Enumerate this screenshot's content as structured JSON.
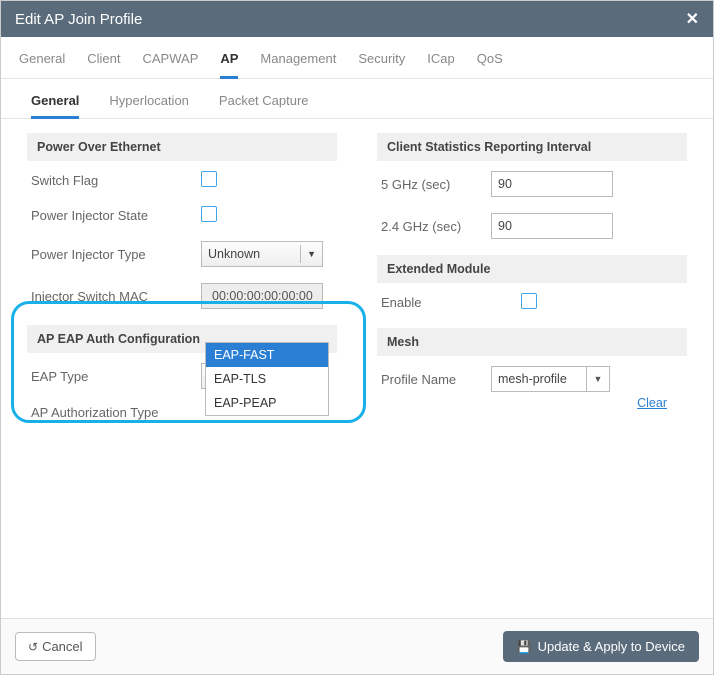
{
  "header": {
    "title": "Edit AP Join Profile"
  },
  "topTabs": [
    "General",
    "Client",
    "CAPWAP",
    "AP",
    "Management",
    "Security",
    "ICap",
    "QoS"
  ],
  "topTabActive": 3,
  "subTabs": [
    "General",
    "Hyperlocation",
    "Packet Capture"
  ],
  "subTabActive": 0,
  "poe": {
    "header": "Power Over Ethernet",
    "switchFlag": "Switch Flag",
    "injectorState": "Power Injector State",
    "injectorType": "Power Injector Type",
    "injectorTypeValue": "Unknown",
    "injectorMac": "Injector Switch MAC",
    "injectorMacValue": "00:00:00:00:00:00"
  },
  "eap": {
    "header": "AP EAP Auth Configuration",
    "typeLabel": "EAP Type",
    "typeValue": "EAP-FAST",
    "options": [
      "EAP-FAST",
      "EAP-TLS",
      "EAP-PEAP"
    ],
    "authLabel": "AP Authorization Type"
  },
  "stats": {
    "header": "Client Statistics Reporting Interval",
    "fiveLabel": "5 GHz (sec)",
    "fiveValue": "90",
    "twoLabel": "2.4 GHz (sec)",
    "twoValue": "90"
  },
  "ext": {
    "header": "Extended Module",
    "enable": "Enable"
  },
  "mesh": {
    "header": "Mesh",
    "profileLabel": "Profile Name",
    "profileValue": "mesh-profile",
    "clear": "Clear"
  },
  "footer": {
    "cancel": "Cancel",
    "apply": "Update & Apply to Device"
  }
}
